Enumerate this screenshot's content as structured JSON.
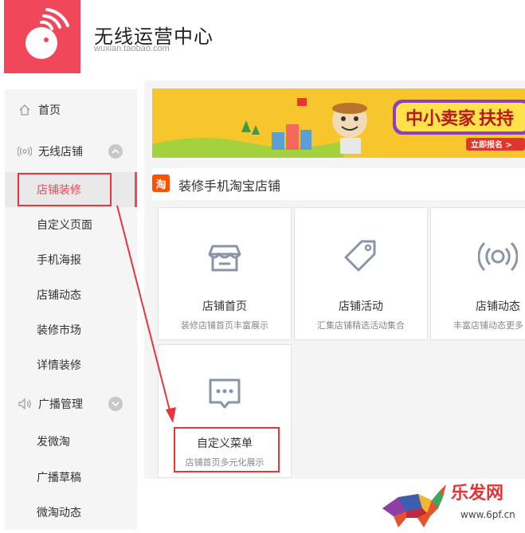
{
  "header": {
    "title": "无线运营中心",
    "domain": "wuxian.taobao.com"
  },
  "sidebar": {
    "home": "首页",
    "group1": "无线店铺",
    "group1_items": [
      "店铺装修",
      "自定义页面",
      "手机海报",
      "店铺动态",
      "装修市场",
      "详情装修"
    ],
    "group2": "广播管理",
    "group2_items": [
      "发微淘",
      "广播草稿",
      "微淘动态"
    ]
  },
  "banner": {
    "headline": "中小卖家",
    "headline2": "扶持",
    "cta": "立即报名 >"
  },
  "section": {
    "badge": "淘",
    "title": "装修手机淘宝店铺"
  },
  "cards": [
    {
      "icon": "shop-icon",
      "title": "店铺首页",
      "desc": "装修店铺首页丰富展示"
    },
    {
      "icon": "tag-icon",
      "title": "店铺活动",
      "desc": "汇集店铺精选活动集合"
    },
    {
      "icon": "broadcast-icon",
      "title": "店铺动态",
      "desc": "丰富店铺动态更多"
    },
    {
      "icon": "chat-menu-icon",
      "title": "自定义菜单",
      "desc": "店铺首页多元化展示"
    }
  ],
  "watermark": {
    "brand": "乐发网",
    "url": "www.6pf.cn"
  },
  "colors": {
    "brand_red": "#f0485a",
    "active_text": "#e94b59",
    "annotation_red": "#e8343d",
    "icon_gray": "#8a94a8"
  }
}
